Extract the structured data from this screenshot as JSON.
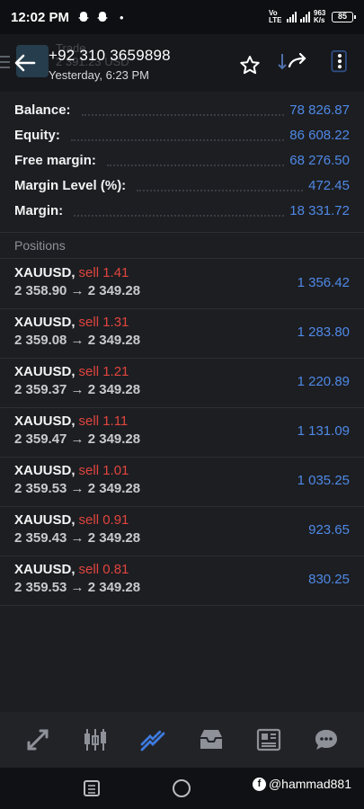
{
  "status_bar": {
    "time": "12:02 PM",
    "network_label": "Vo LTE",
    "network_speed": "963 K/s",
    "battery": "85"
  },
  "header": {
    "account_number": "+92 310 3659898",
    "last_update": "Yesterday, 6:23 PM",
    "background_title": "Trade",
    "background_subtitle": "2 391.23 USD"
  },
  "summary": [
    {
      "label": "Balance:",
      "value": "78 826.87"
    },
    {
      "label": "Equity:",
      "value": "86 608.22"
    },
    {
      "label": "Free margin:",
      "value": "68 276.50"
    },
    {
      "label": "Margin Level (%):",
      "value": "472.45"
    },
    {
      "label": "Margin:",
      "value": "18 331.72"
    }
  ],
  "positions_title": "Positions",
  "positions": [
    {
      "symbol": "XAUUSD,",
      "side": "sell 1.41",
      "prices": "2 358.90 → 2 349.28",
      "profit": "1 356.42"
    },
    {
      "symbol": "XAUUSD,",
      "side": "sell 1.31",
      "prices": "2 359.08 → 2 349.28",
      "profit": "1 283.80"
    },
    {
      "symbol": "XAUUSD,",
      "side": "sell 1.21",
      "prices": "2 359.37 → 2 349.28",
      "profit": "1 220.89"
    },
    {
      "symbol": "XAUUSD,",
      "side": "sell 1.11",
      "prices": "2 359.47 → 2 349.28",
      "profit": "1 131.09"
    },
    {
      "symbol": "XAUUSD,",
      "side": "sell 1.01",
      "prices": "2 359.53 → 2 349.28",
      "profit": "1 035.25"
    },
    {
      "symbol": "XAUUSD,",
      "side": "sell 0.91",
      "prices": "2 359.43 → 2 349.28",
      "profit": "923.65"
    },
    {
      "symbol": "XAUUSD,",
      "side": "sell 0.81",
      "prices": "2 359.53 → 2 349.28",
      "profit": "830.25"
    }
  ],
  "bottom_nav": [
    {
      "icon": "quotes-icon",
      "active": false
    },
    {
      "icon": "chart-icon",
      "active": false
    },
    {
      "icon": "trade-icon",
      "active": true
    },
    {
      "icon": "history-icon",
      "active": false
    },
    {
      "icon": "news-icon",
      "active": false
    },
    {
      "icon": "messages-icon",
      "active": false
    }
  ],
  "watermark": "@hammad881",
  "colors": {
    "background": "#1d1e22",
    "value_blue": "#4e89e6",
    "sell_red": "#e0453e",
    "active_nav": "#3e7be0"
  }
}
